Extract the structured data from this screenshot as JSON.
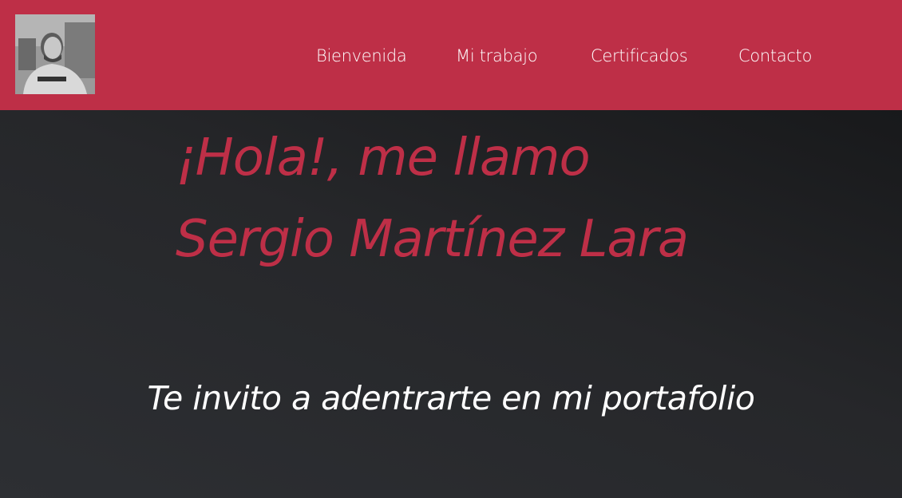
{
  "nav": {
    "avatar_alt": "profile-photo",
    "links": [
      {
        "label": "Bienvenida"
      },
      {
        "label": "Mi trabajo"
      },
      {
        "label": "Certificados"
      },
      {
        "label": "Contacto"
      }
    ]
  },
  "hero": {
    "greeting_line1": "¡Hola!, me llamo",
    "greeting_line2": "Sergio Martínez Lara",
    "tagline": "Te invito a adentrarte en mi portafolio"
  },
  "colors": {
    "brand": "#be2f47",
    "background": "#25262a",
    "text_light": "#ffffff"
  }
}
